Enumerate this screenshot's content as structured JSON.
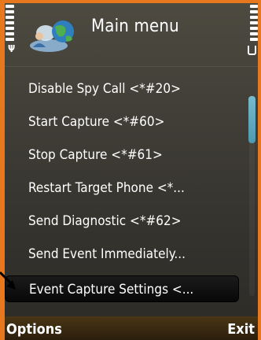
{
  "header": {
    "title": "Main menu",
    "icon": "globe-user-icon"
  },
  "menu": {
    "items": [
      {
        "label": "Disable Spy Call <*#20>",
        "selected": false
      },
      {
        "label": "Start Capture <*#60>",
        "selected": false
      },
      {
        "label": "Stop Capture <*#61>",
        "selected": false
      },
      {
        "label": "Restart Target Phone <*...",
        "selected": false
      },
      {
        "label": "Send Diagnostic <*#62>",
        "selected": false
      },
      {
        "label": "Send Event Immediately...",
        "selected": false
      },
      {
        "label": "Event Capture Settings <...",
        "selected": true
      }
    ]
  },
  "softkeys": {
    "left_label": "Options",
    "right_label": "Exit"
  },
  "colors": {
    "frame": "#e8781e",
    "screen_bg": "#3e3c35",
    "selection_bg": "#111111",
    "scroll_thumb": "#6bbfd9"
  }
}
